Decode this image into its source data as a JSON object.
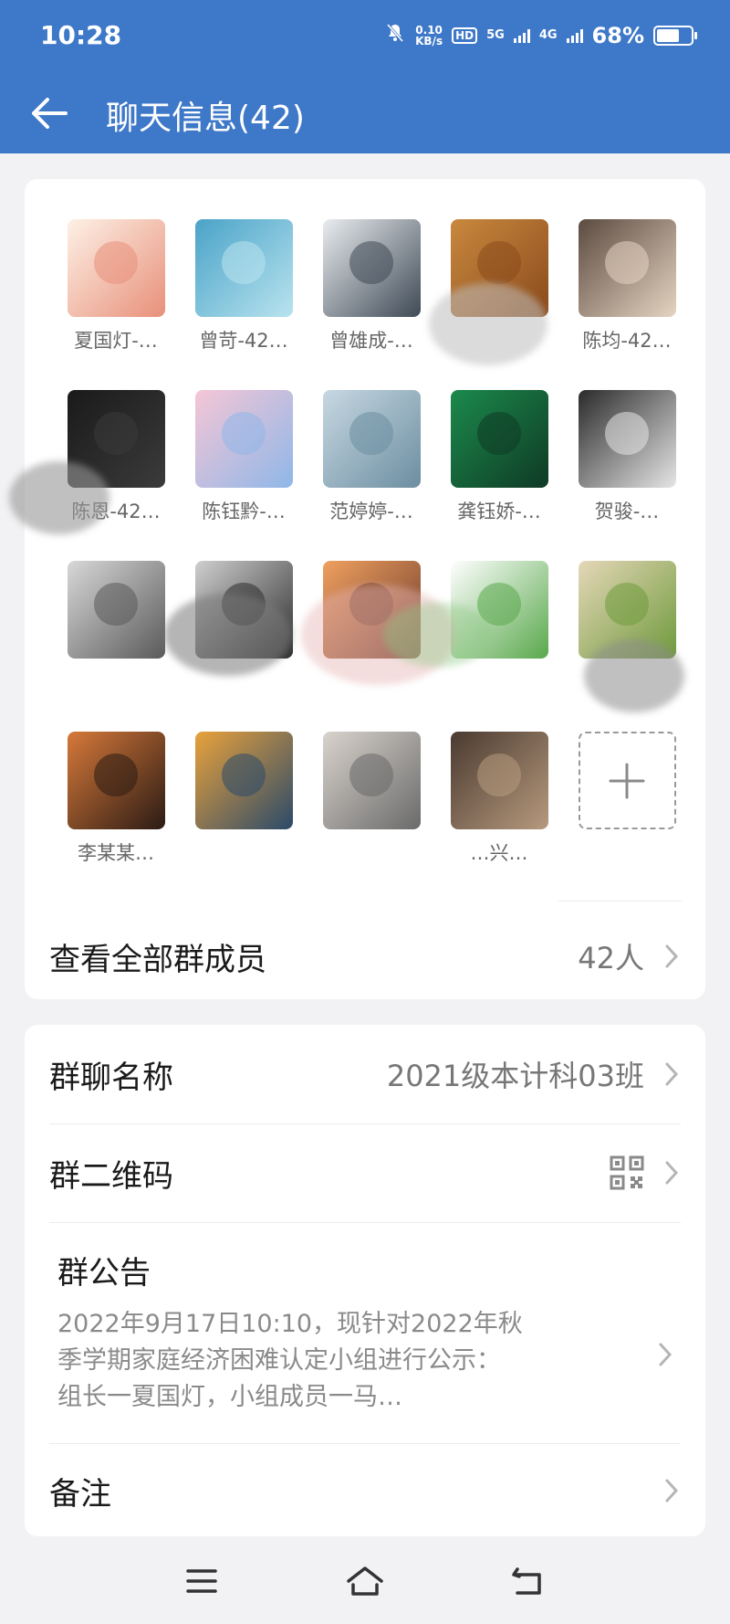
{
  "status_bar": {
    "time": "10:28",
    "net_speed_value": "0.10",
    "net_speed_unit": "KB/s",
    "hd_label": "HD",
    "signal1_label": "5G",
    "signal2_label": "4G",
    "battery_percent": "68%",
    "battery_level": 0.68
  },
  "header": {
    "title": "聊天信息(42)"
  },
  "members": [
    {
      "name": "夏国灯-…",
      "colors": [
        "#fdf1e6",
        "#e8907a"
      ]
    },
    {
      "name": "曾苛-42…",
      "colors": [
        "#4aa3c8",
        "#b9e3ef"
      ]
    },
    {
      "name": "曾雄成-…",
      "colors": [
        "#e9ecef",
        "#3f4a56"
      ]
    },
    {
      "name": "",
      "colors": [
        "#c9893e",
        "#8a4a1c"
      ]
    },
    {
      "name": "陈均-42…",
      "colors": [
        "#5b4a3f",
        "#e6d4c2"
      ]
    },
    {
      "name": "陈恩-42…",
      "colors": [
        "#1a1a1a",
        "#3b3b3b"
      ]
    },
    {
      "name": "陈钰黔-…",
      "colors": [
        "#f5c6d6",
        "#8fb7e8"
      ]
    },
    {
      "name": "范婷婷-…",
      "colors": [
        "#c7d8e2",
        "#6c8ea1"
      ]
    },
    {
      "name": "龚钰娇-…",
      "colors": [
        "#1b8a4c",
        "#0f3a25"
      ]
    },
    {
      "name": "贺骏-…",
      "colors": [
        "#2a2a2a",
        "#e6e6e6"
      ]
    },
    {
      "name": "",
      "colors": [
        "#d8d8d8",
        "#5a5a5a"
      ]
    },
    {
      "name": "",
      "colors": [
        "#cfcfcf",
        "#2e2e2e"
      ]
    },
    {
      "name": "",
      "colors": [
        "#f0a060",
        "#6a3a2a"
      ]
    },
    {
      "name": "",
      "colors": [
        "#ffffff",
        "#59a84c"
      ]
    },
    {
      "name": "",
      "colors": [
        "#e5d7b8",
        "#6f9a3c"
      ]
    },
    {
      "name": "李某某…",
      "colors": [
        "#d6793a",
        "#2b1b14"
      ]
    },
    {
      "name": "",
      "colors": [
        "#e9a23b",
        "#2b4a6a"
      ]
    },
    {
      "name": "",
      "colors": [
        "#d9d3cd",
        "#6a6a6a"
      ]
    },
    {
      "name": "…兴…",
      "colors": [
        "#4a3a30",
        "#b79a7e"
      ]
    }
  ],
  "view_all": {
    "label": "查看全部群成员",
    "count": "42人"
  },
  "group_name": {
    "label": "群聊名称",
    "value": "2021级本计科03班"
  },
  "qr_code": {
    "label": "群二维码"
  },
  "notice": {
    "label": "群公告",
    "line1": "2022年9月17日10:10，现针对2022年秋",
    "line2": "季学期家庭经济困难认定小组进行公示：",
    "line3": "组长一夏国灯，小组成员一马…"
  },
  "remark": {
    "label": "备注"
  },
  "colors": {
    "header_bg": "#3e78c8",
    "page_bg": "#f2f2f4"
  }
}
